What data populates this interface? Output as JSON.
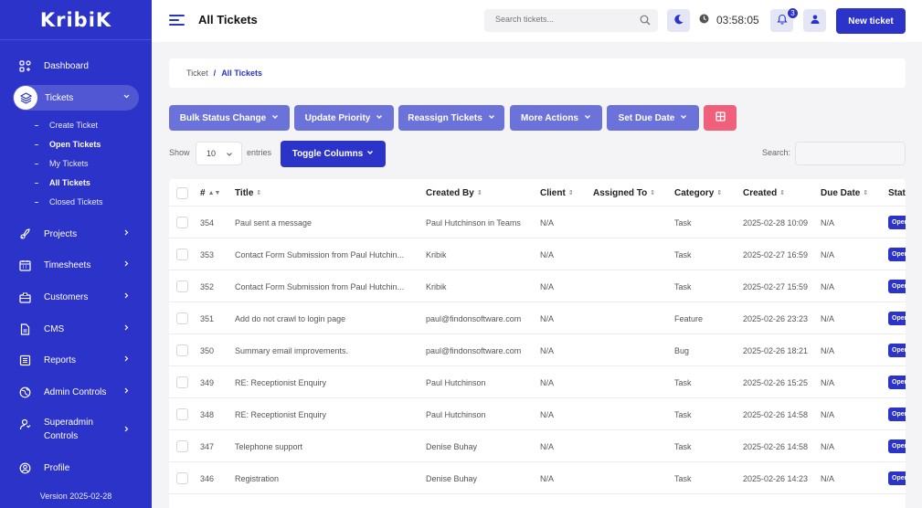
{
  "sidebar": {
    "logo": "KribiK",
    "items": [
      {
        "label": "Dashboard"
      },
      {
        "label": "Tickets"
      },
      {
        "label": "Projects"
      },
      {
        "label": "Timesheets"
      },
      {
        "label": "Customers"
      },
      {
        "label": "CMS"
      },
      {
        "label": "Reports"
      },
      {
        "label": "Admin Controls"
      },
      {
        "label": "Superadmin Controls"
      },
      {
        "label": "Profile"
      }
    ],
    "ticket_subitems": [
      {
        "label": "Create Ticket"
      },
      {
        "label": "Open Tickets"
      },
      {
        "label": "My Tickets"
      },
      {
        "label": "All Tickets"
      },
      {
        "label": "Closed Tickets"
      }
    ],
    "version": "Version 2025-02-28"
  },
  "header": {
    "title": "All Tickets",
    "search_placeholder": "Search tickets...",
    "timer": "03:58:05",
    "notification_count": "3",
    "new_ticket_label": "New ticket"
  },
  "breadcrumb": {
    "parent": "Ticket",
    "separator": "/",
    "current": "All Tickets"
  },
  "actions": {
    "bulk_status": "Bulk Status Change",
    "update_priority": "Update Priority",
    "reassign": "Reassign Tickets",
    "more_actions": "More Actions",
    "set_due_date": "Set Due Date"
  },
  "table_controls": {
    "show_label": "Show",
    "entries_value": "10",
    "entries_label": "entries",
    "toggle_columns": "Toggle Columns",
    "search_label": "Search:"
  },
  "table": {
    "headers": [
      "#",
      "Title",
      "Created By",
      "Client",
      "Assigned To",
      "Category",
      "Created",
      "Due Date",
      "Stat"
    ],
    "status_badge": "Open",
    "rows": [
      {
        "id": "354",
        "title": "Paul sent a message",
        "created_by": "Paul Hutchinson in Teams",
        "client": "N/A",
        "assigned_to": "",
        "category": "Task",
        "created": "2025-02-28 10:09",
        "due": "N/A"
      },
      {
        "id": "353",
        "title": "Contact Form Submission from Paul Hutchin...",
        "created_by": "Kribik",
        "client": "N/A",
        "assigned_to": "",
        "category": "Task",
        "created": "2025-02-27 16:59",
        "due": "N/A"
      },
      {
        "id": "352",
        "title": "Contact Form Submission from Paul Hutchin...",
        "created_by": "Kribik",
        "client": "N/A",
        "assigned_to": "",
        "category": "Task",
        "created": "2025-02-27 15:59",
        "due": "N/A"
      },
      {
        "id": "351",
        "title": "Add do not crawl to login page",
        "created_by": "paul@findonsoftware.com",
        "client": "N/A",
        "assigned_to": "",
        "category": "Feature",
        "created": "2025-02-26 23:23",
        "due": "N/A"
      },
      {
        "id": "350",
        "title": "Summary email improvements.",
        "created_by": "paul@findonsoftware.com",
        "client": "N/A",
        "assigned_to": "",
        "category": "Bug",
        "created": "2025-02-26 18:21",
        "due": "N/A"
      },
      {
        "id": "349",
        "title": "RE: Receptionist Enquiry",
        "created_by": "Paul Hutchinson",
        "client": "N/A",
        "assigned_to": "",
        "category": "Task",
        "created": "2025-02-26 15:25",
        "due": "N/A"
      },
      {
        "id": "348",
        "title": "RE: Receptionist Enquiry",
        "created_by": "Paul Hutchinson",
        "client": "N/A",
        "assigned_to": "",
        "category": "Task",
        "created": "2025-02-26 14:58",
        "due": "N/A"
      },
      {
        "id": "347",
        "title": "Telephone support",
        "created_by": "Denise Buhay",
        "client": "N/A",
        "assigned_to": "",
        "category": "Task",
        "created": "2025-02-26 14:58",
        "due": "N/A"
      },
      {
        "id": "346",
        "title": "Registration",
        "created_by": "Denise Buhay",
        "client": "N/A",
        "assigned_to": "",
        "category": "Task",
        "created": "2025-02-26 14:23",
        "due": "N/A"
      }
    ]
  },
  "colors": {
    "primary": "#2b33c9",
    "action": "#6b72d9",
    "danger": "#f0607a"
  }
}
